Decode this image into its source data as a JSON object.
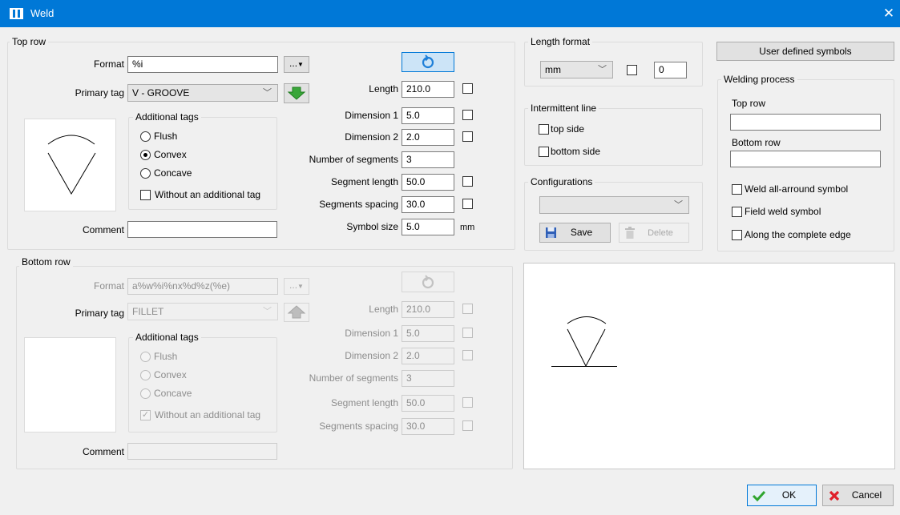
{
  "window": {
    "title": "Weld",
    "close_glyph": "✕"
  },
  "top_row": {
    "group_title": "Top row",
    "format_label": "Format",
    "format_value": "%i",
    "format_button": "...",
    "primary_tag_label": "Primary tag",
    "primary_tag_value": "V - GROOVE",
    "additional_tags_title": "Additional tags",
    "radios": [
      {
        "label": "Flush",
        "selected": false
      },
      {
        "label": "Convex",
        "selected": true
      },
      {
        "label": "Concave",
        "selected": false
      }
    ],
    "without_tag_label": "Without an additional tag",
    "without_tag_checked": false,
    "comment_label": "Comment",
    "comment_value": "",
    "fields": [
      {
        "label": "Length",
        "value": "210.0"
      },
      {
        "label": "Dimension 1",
        "value": "5.0"
      },
      {
        "label": "Dimension 2",
        "value": "2.0"
      },
      {
        "label": "Number of segments",
        "value": "3"
      },
      {
        "label": "Segment length",
        "value": "50.0"
      },
      {
        "label": "Segments spacing",
        "value": "30.0"
      },
      {
        "label": "Symbol size",
        "value": "5.0"
      }
    ],
    "symbol_size_unit": "mm"
  },
  "bottom_row": {
    "group_title": "Bottom row",
    "format_label": "Format",
    "format_value": "a%w%i%nx%d%z(%e)",
    "format_button": "...",
    "primary_tag_label": "Primary tag",
    "primary_tag_value": "FILLET",
    "additional_tags_title": "Additional tags",
    "radios": [
      {
        "label": "Flush"
      },
      {
        "label": "Convex"
      },
      {
        "label": "Concave"
      }
    ],
    "without_tag_label": "Without an additional tag",
    "without_tag_checked": true,
    "comment_label": "Comment",
    "comment_value": "",
    "fields": [
      {
        "label": "Length",
        "value": "210.0"
      },
      {
        "label": "Dimension 1",
        "value": "5.0"
      },
      {
        "label": "Dimension 2",
        "value": "2.0"
      },
      {
        "label": "Number of segments",
        "value": "3"
      },
      {
        "label": "Segment length",
        "value": "50.0"
      },
      {
        "label": "Segments spacing",
        "value": "30.0"
      }
    ]
  },
  "length_format": {
    "title": "Length format",
    "unit_value": "mm",
    "checked": false,
    "number_value": "0"
  },
  "intermittent_line": {
    "title": "Intermittent line",
    "top_side_label": "top side",
    "bottom_side_label": "bottom side"
  },
  "configurations": {
    "title": "Configurations",
    "selected": "",
    "save_label": "Save",
    "delete_label": "Delete"
  },
  "user_defined_symbols_label": "User defined symbols",
  "welding_process": {
    "title": "Welding process",
    "top_row_label": "Top row",
    "top_row_value": "",
    "bottom_row_label": "Bottom row",
    "bottom_row_value": "",
    "options": [
      {
        "label": "Weld all-arround symbol",
        "checked": false
      },
      {
        "label": "Field weld symbol",
        "checked": false
      },
      {
        "label": "Along the complete edge",
        "checked": false
      }
    ]
  },
  "footer": {
    "ok_label": "OK",
    "cancel_label": "Cancel"
  },
  "colors": {
    "titlebar": "#0078d7",
    "accent_arrow": "#3aa63a",
    "cancel_x": "#e0202a",
    "ok_check": "#2fa52f"
  }
}
